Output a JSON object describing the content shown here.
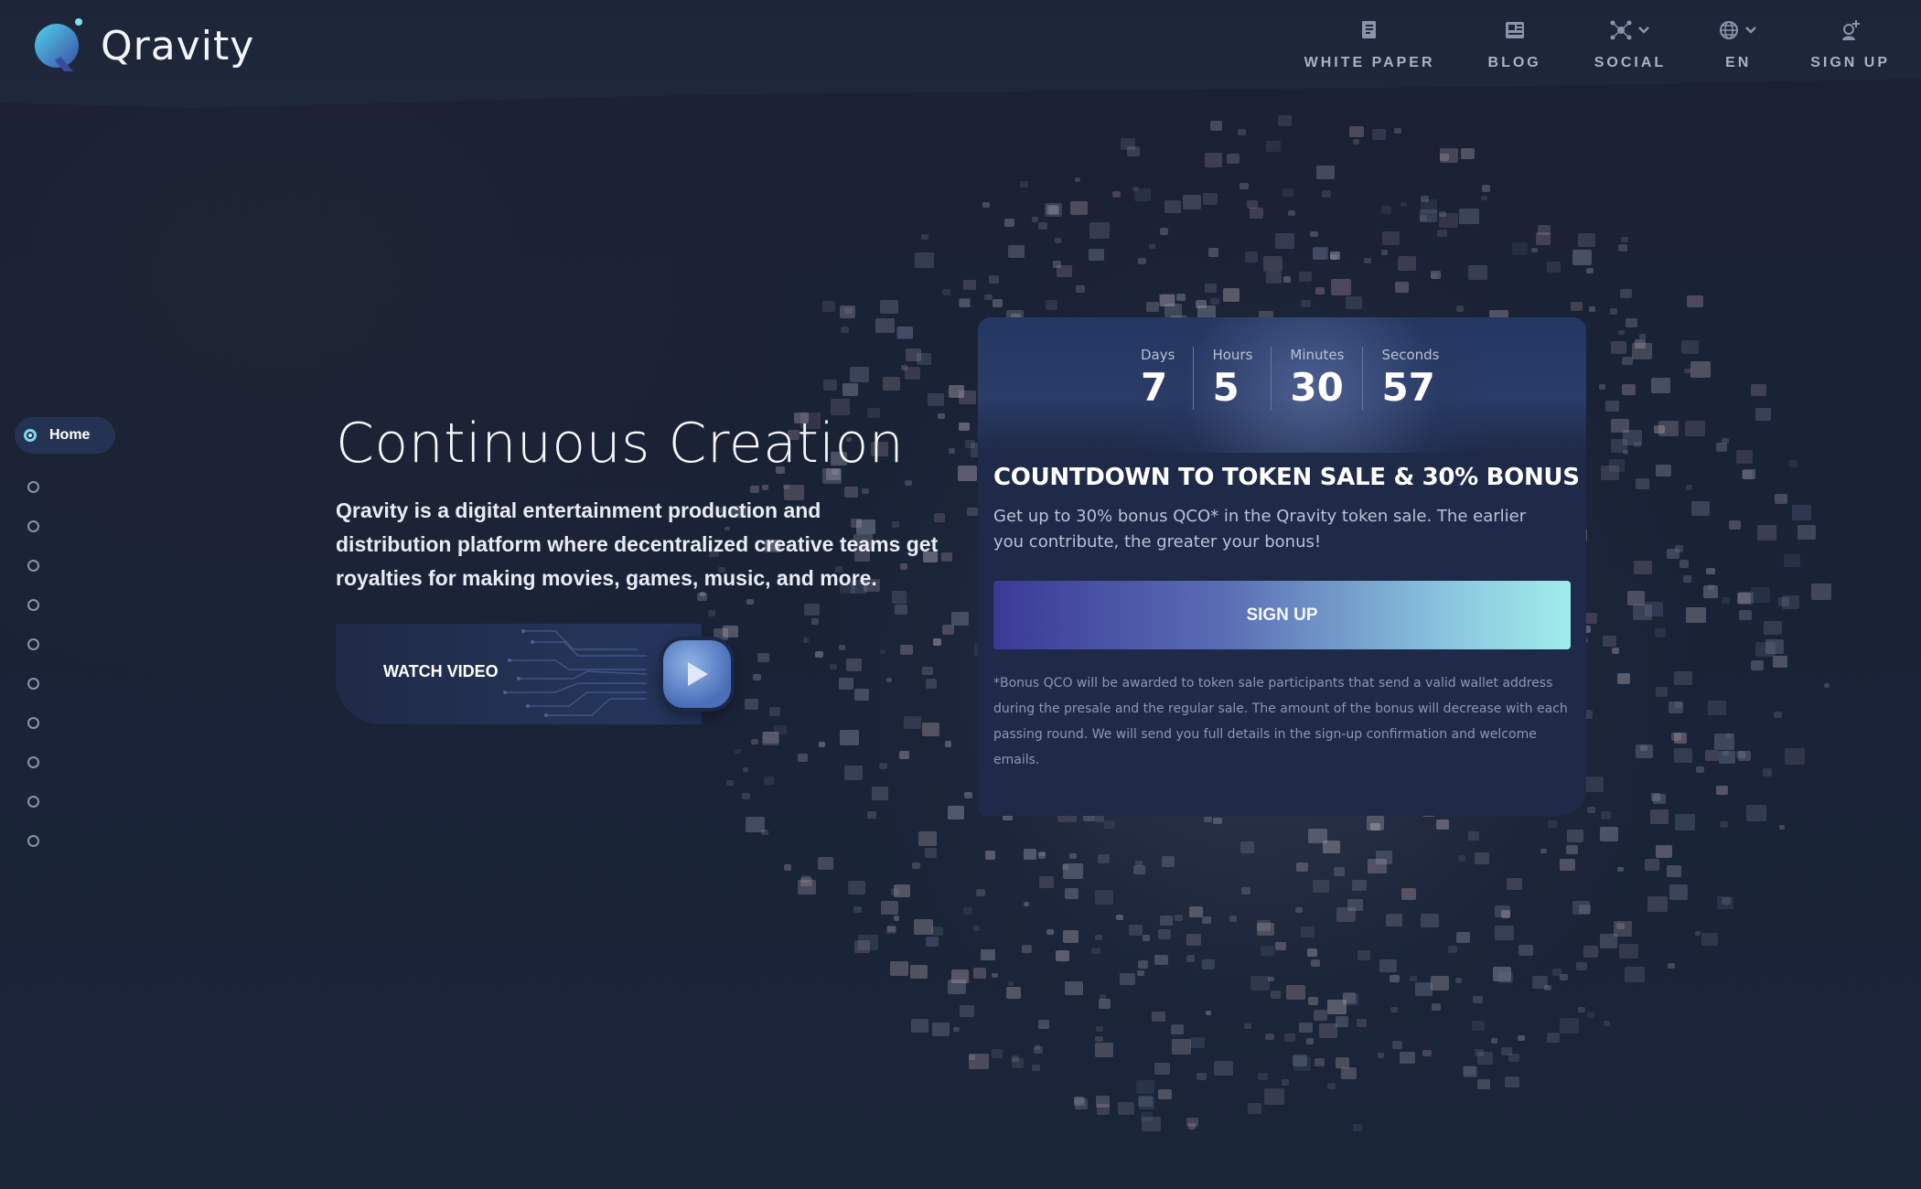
{
  "brand": {
    "name": "Qravity"
  },
  "nav": [
    {
      "label": "WHITE PAPER",
      "icon": "document-icon"
    },
    {
      "label": "BLOG",
      "icon": "newspaper-icon"
    },
    {
      "label": "SOCIAL",
      "icon": "network-icon"
    },
    {
      "label": "EN",
      "icon": "globe-icon"
    },
    {
      "label": "SIGN UP",
      "icon": "user-add-icon"
    }
  ],
  "side_nav": {
    "active_label": "Home",
    "inactive_count": 10
  },
  "hero": {
    "title": "Continuous Creation",
    "subtitle": "Qravity is a digital entertainment production and distribution platform where decentralized creative teams get royalties for making movies, games, music, and more.",
    "watch_label": "WATCH VIDEO"
  },
  "countdown": {
    "days_label": "Days",
    "days": "7",
    "hours_label": "Hours",
    "hours": "5",
    "minutes_label": "Minutes",
    "minutes": "30",
    "seconds_label": "Seconds",
    "seconds": "57"
  },
  "card": {
    "title": "COUNTDOWN TO TOKEN SALE & 30% BONUS",
    "text": "Get up to 30% bonus QCO* in the Qravity token sale. The earlier you contribute, the greater your bonus!",
    "button": "SIGN UP",
    "note": "*Bonus QCO will be awarded to token sale participants that send a valid wallet address during the presale and the regular sale. The amount of the bonus will decrease with each passing round. We will send you full details in the sign-up confirmation and welcome emails."
  },
  "colors": {
    "accent": "#7fd6ea",
    "background": "#172033",
    "card": "#1e2a47"
  }
}
